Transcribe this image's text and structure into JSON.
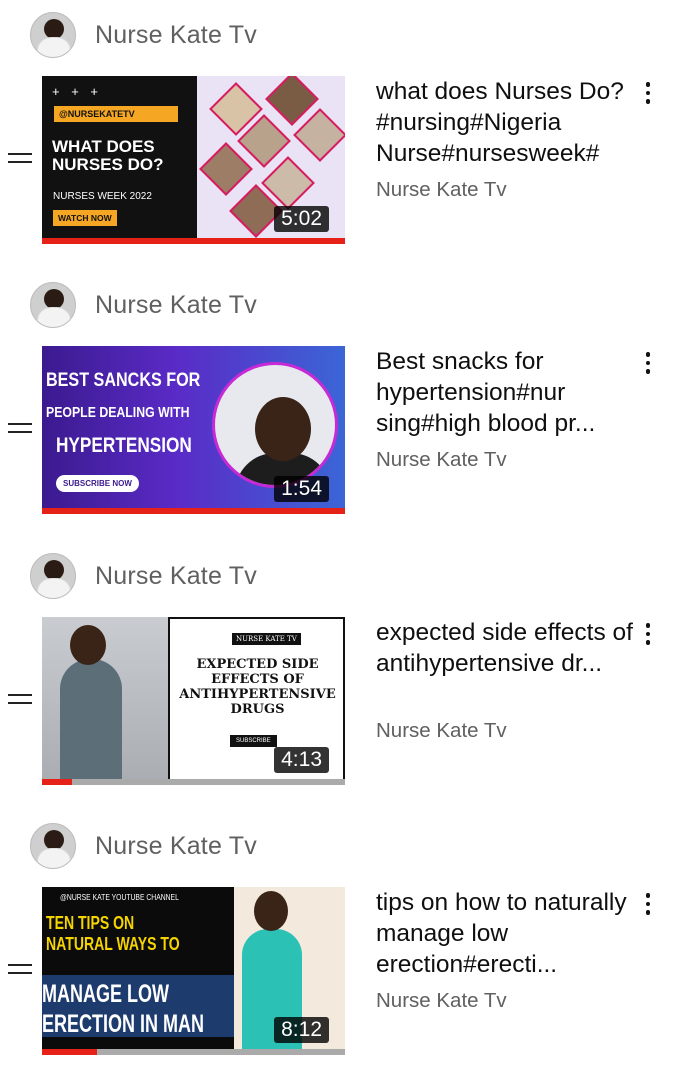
{
  "videos": [
    {
      "channel": "Nurse Kate Tv",
      "title": "what does Nurses Do?#nursing#Nigeria Nurse#nursesweek#",
      "subtitle": "Nurse Kate Tv",
      "duration": "5:02",
      "progress": 0,
      "thumb": {
        "plus": "+ + +",
        "handle": "@NURSEKATETV",
        "heading": "WHAT DOES NURSES DO?",
        "week": "NURSES WEEK 2022",
        "watch": "WATCH NOW"
      }
    },
    {
      "channel": "Nurse Kate Tv",
      "title": "Best snacks for hypertension#nur sing#high blood pr...",
      "subtitle": "Nurse Kate Tv",
      "duration": "1:54",
      "progress": 0,
      "thumb": {
        "line1": "BEST SANCKS FOR",
        "line2": "PEOPLE DEALING WITH",
        "line3": "HYPERTENSION",
        "subscribe": "SUBSCRIBE NOW"
      }
    },
    {
      "channel": "Nurse Kate Tv",
      "title": "expected side effects of antihypertensive dr...",
      "subtitle": "Nurse Kate Tv",
      "duration": "4:13",
      "progress": 0.1,
      "thumb": {
        "tag": "NURSE KATE TV",
        "heading": "EXPECTED SIDE EFFECTS OF ANTIHYPERTENSIVE DRUGS",
        "subscribe": "SUBSCRIBE"
      }
    },
    {
      "channel": "Nurse Kate Tv",
      "title": "tips on how to naturally manage low erection#erecti...",
      "subtitle": "Nurse Kate Tv",
      "duration": "8:12",
      "progress": 0.18,
      "thumb": {
        "channel_tag": "@NURSE KATE YOUTUBE CHANNEL",
        "line1": "TEN TIPS ON",
        "line2": "NATURAL WAYS TO",
        "line3": "MANAGE LOW",
        "line4": "ERECTION IN MAN"
      }
    }
  ],
  "colors": {
    "progress": "#e62117",
    "secondary_text": "#606060"
  }
}
